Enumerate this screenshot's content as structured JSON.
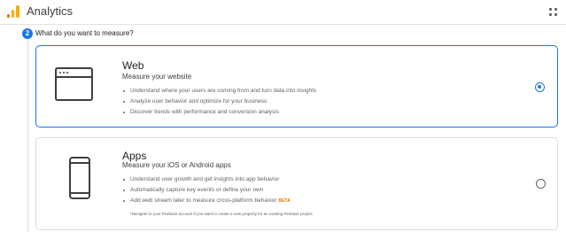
{
  "header": {
    "title": "Analytics",
    "logo_icon": "analytics-logo-icon",
    "apps_icon": "apps-grid-icon",
    "brand_colors": [
      "#e37400",
      "#f9ab00"
    ]
  },
  "step": {
    "number": "2",
    "title": "What do you want to measure?",
    "accent_color": "#1a73e8"
  },
  "options": [
    {
      "title": "Web",
      "subtitle": "Measure your website",
      "icon": "browser-window-icon",
      "selected": true,
      "bullets": [
        "Understand where your users are coming from and turn data into insights",
        "Analyze user behavior and optimize for your business",
        "Discover trends with performance and conversion analysis"
      ]
    },
    {
      "title": "Apps",
      "subtitle": "Measure your iOS or Android apps",
      "icon": "mobile-phone-icon",
      "selected": false,
      "bullets": [
        "Understand user growth and get insights into app behavior",
        "Automatically capture key events or define your own",
        "Add web stream later to measure cross-platform behavior"
      ],
      "badge": "BETA",
      "note": "*Navigate to your Firebase account if you want to create a new property for an existing Firebase project"
    }
  ]
}
